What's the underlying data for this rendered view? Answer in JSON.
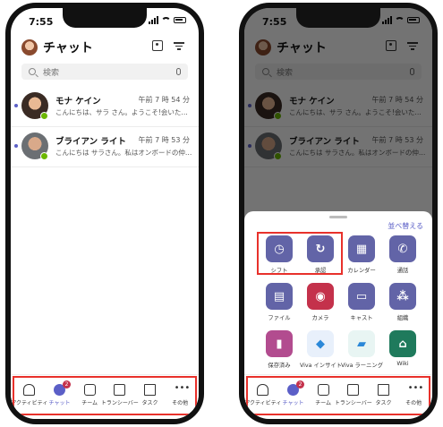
{
  "status": {
    "time": "7:55"
  },
  "header": {
    "title": "チャット"
  },
  "search": {
    "placeholder": "検索"
  },
  "chats": [
    {
      "name": "モナ ケイン",
      "time": "午前 7 時 54 分",
      "message": "こんにちは、サラ さん。ようこそ!会いたかったけど..."
    },
    {
      "name": "ブライアン ライト",
      "time": "午前 7 時 53 分",
      "message": "こんにちは サラさん。私はオンボードの仲間です!"
    }
  ],
  "tabs": [
    {
      "label": "アクティビティ",
      "icon": "bell-icon"
    },
    {
      "label": "チャット",
      "icon": "chat-icon",
      "badge": "2"
    },
    {
      "label": "チーム",
      "icon": "teams-icon"
    },
    {
      "label": "トランシーバー",
      "icon": "walkie-talkie-icon"
    },
    {
      "label": "タスク",
      "icon": "tasks-icon"
    },
    {
      "label": "その他",
      "icon": "more-icon"
    }
  ],
  "sheet": {
    "reorder_label": "並べ替える",
    "apps": [
      {
        "label": "シフト",
        "icon": "clock-icon",
        "color": "#6264a7"
      },
      {
        "label": "承認",
        "icon": "approvals-icon",
        "color": "#6264a7"
      },
      {
        "label": "カレンダー",
        "icon": "calendar-icon",
        "color": "#6264a7"
      },
      {
        "label": "通話",
        "icon": "phone-icon",
        "color": "#6264a7"
      },
      {
        "label": "ファイル",
        "icon": "file-icon",
        "color": "#6264a7"
      },
      {
        "label": "カメラ",
        "icon": "camera-icon",
        "color": "#c4314b"
      },
      {
        "label": "キャスト",
        "icon": "cast-icon",
        "color": "#6264a7"
      },
      {
        "label": "組織",
        "icon": "org-icon",
        "color": "#6264a7"
      },
      {
        "label": "保存済み",
        "icon": "bookmark-icon",
        "color": "#b24c8f"
      },
      {
        "label": "Viva インサイト",
        "icon": "viva-insights-icon",
        "color": "#e8f0fb"
      },
      {
        "label": "Viva ラーニング",
        "icon": "viva-learning-icon",
        "color": "#e8f5f3"
      },
      {
        "label": "Wiki",
        "icon": "wiki-icon",
        "color": "#1f7a5c"
      }
    ]
  },
  "colors": {
    "accent": "#5b5fc7",
    "highlight": "#e8312b",
    "presence": "#6bb700"
  }
}
